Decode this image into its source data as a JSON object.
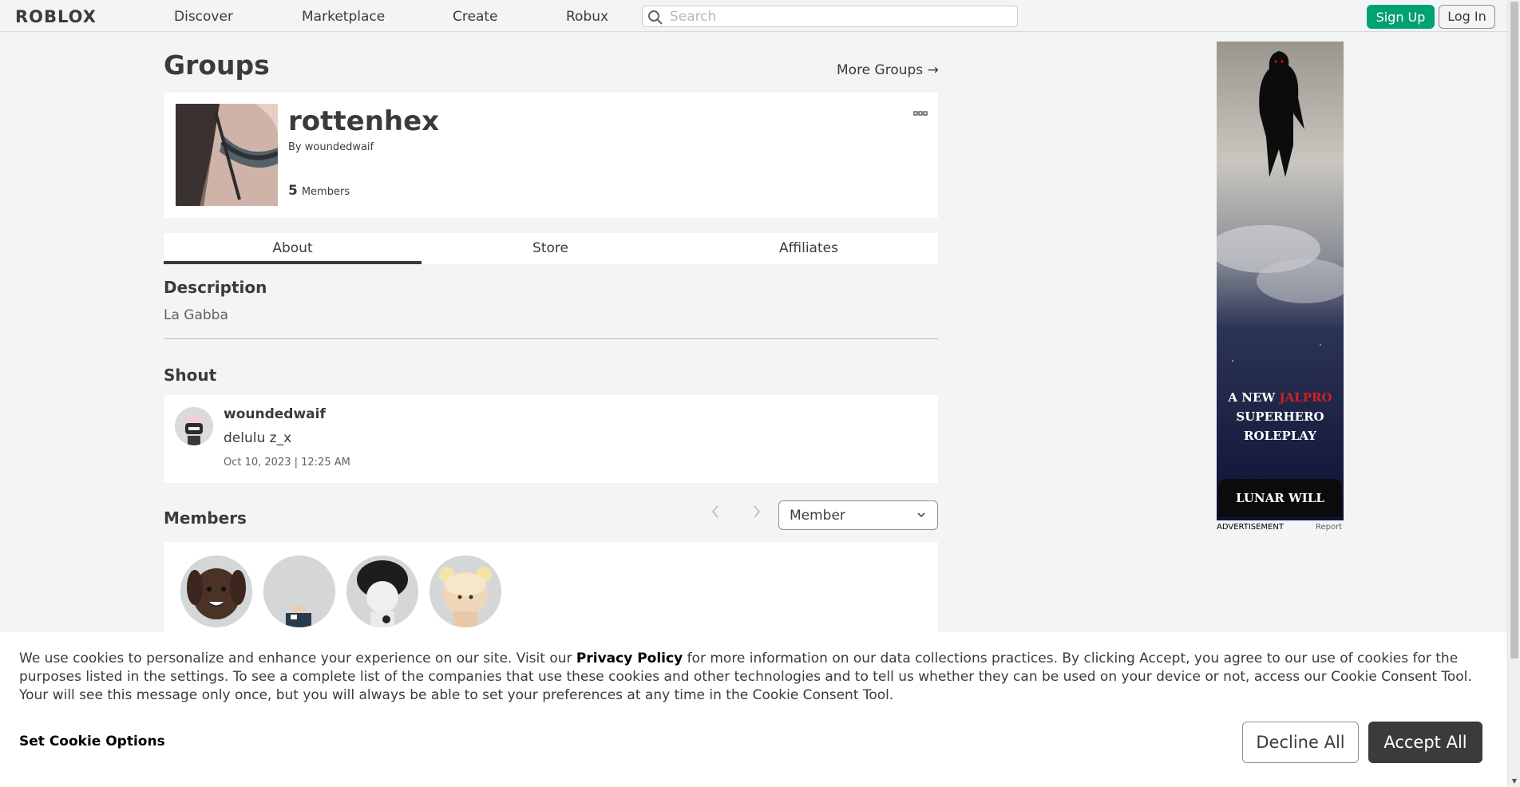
{
  "nav": {
    "logo": "ROBLOX",
    "links": [
      "Discover",
      "Marketplace",
      "Create",
      "Robux"
    ],
    "search_placeholder": "Search",
    "signup": "Sign Up",
    "login": "Log In"
  },
  "page": {
    "title": "Groups",
    "more_groups": "More Groups →"
  },
  "group": {
    "name": "rottenhex",
    "by_label": "By",
    "owner": "woundedwaif",
    "member_count": "5",
    "members_label": "Members",
    "more_icon": "more-options-icon"
  },
  "tabs": [
    "About",
    "Store",
    "Affiliates"
  ],
  "description": {
    "heading": "Description",
    "text": "La Gabba"
  },
  "shout": {
    "heading": "Shout",
    "user": "woundedwaif",
    "message": "delulu z_x",
    "date": "Oct 10, 2023 | 12:25 AM"
  },
  "members": {
    "heading": "Members",
    "role_selected": "Member",
    "prev_icon": "chevron-left-icon",
    "next_icon": "chevron-right-icon"
  },
  "ad": {
    "headline_1": "A NEW",
    "headline_brand": "JALPRO",
    "headline_2": "SUPERHERO",
    "headline_3": "ROLEPLAY",
    "logo_text": "LUNAR WILL",
    "label": "ADVERTISEMENT",
    "report": "Report"
  },
  "cookie": {
    "text_before": "We use cookies to personalize and enhance your experience on our site. Visit our ",
    "privacy_link": "Privacy Policy",
    "text_after": " for more information on our data collections practices. By clicking Accept, you agree to our use of cookies for the purposes listed in the settings. To see a complete list of the companies that use these cookies and other technologies and to tell us whether they can be used on your device or not, access our Cookie Consent Tool. Your will see this message only once, but you will always be able to set your preferences at any time in the Cookie Consent Tool.",
    "options": "Set Cookie Options",
    "decline": "Decline All",
    "accept": "Accept All"
  },
  "colors": {
    "accent_green": "#00a173",
    "text_dark": "#393b3d",
    "background": "#f2f4f5"
  }
}
